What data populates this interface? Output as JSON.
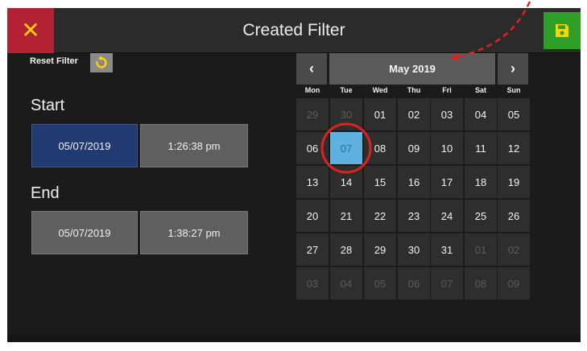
{
  "header": {
    "title": "Created Filter",
    "close_symbol": "✕",
    "close_color": "#b22234",
    "save_color": "#2f9e27"
  },
  "filter": {
    "reset_label": "Reset Filter",
    "start_label": "Start",
    "end_label": "End",
    "start_date": "05/07/2019",
    "start_time": "1:26:38 pm",
    "end_date": "05/07/2019",
    "end_time": "1:38:27 pm"
  },
  "calendar": {
    "month_label": "May 2019",
    "prev_symbol": "‹",
    "next_symbol": "›",
    "weekdays": [
      "Mon",
      "Tue",
      "Wed",
      "Thu",
      "Fri",
      "Sat",
      "Sun"
    ],
    "selected_color": "#5fb2e0",
    "weeks": [
      [
        {
          "d": "29",
          "dim": true
        },
        {
          "d": "30",
          "dim": true
        },
        {
          "d": "01"
        },
        {
          "d": "02"
        },
        {
          "d": "03"
        },
        {
          "d": "04"
        },
        {
          "d": "05"
        }
      ],
      [
        {
          "d": "06"
        },
        {
          "d": "07",
          "selected": true
        },
        {
          "d": "08"
        },
        {
          "d": "09"
        },
        {
          "d": "10"
        },
        {
          "d": "11"
        },
        {
          "d": "12"
        }
      ],
      [
        {
          "d": "13"
        },
        {
          "d": "14"
        },
        {
          "d": "15"
        },
        {
          "d": "16"
        },
        {
          "d": "17"
        },
        {
          "d": "18"
        },
        {
          "d": "19"
        }
      ],
      [
        {
          "d": "20"
        },
        {
          "d": "21"
        },
        {
          "d": "22"
        },
        {
          "d": "23"
        },
        {
          "d": "24"
        },
        {
          "d": "25"
        },
        {
          "d": "26"
        }
      ],
      [
        {
          "d": "27"
        },
        {
          "d": "28"
        },
        {
          "d": "29"
        },
        {
          "d": "30"
        },
        {
          "d": "31"
        },
        {
          "d": "01",
          "dim": true
        },
        {
          "d": "02",
          "dim": true
        }
      ],
      [
        {
          "d": "03",
          "dim": true
        },
        {
          "d": "04",
          "dim": true
        },
        {
          "d": "05",
          "dim": true
        },
        {
          "d": "06",
          "dim": true
        },
        {
          "d": "07",
          "dim": true
        },
        {
          "d": "08",
          "dim": true
        },
        {
          "d": "09",
          "dim": true
        }
      ]
    ]
  },
  "annotations": {
    "circle_color": "#e0221e",
    "arrow_color": "#e0221e"
  }
}
